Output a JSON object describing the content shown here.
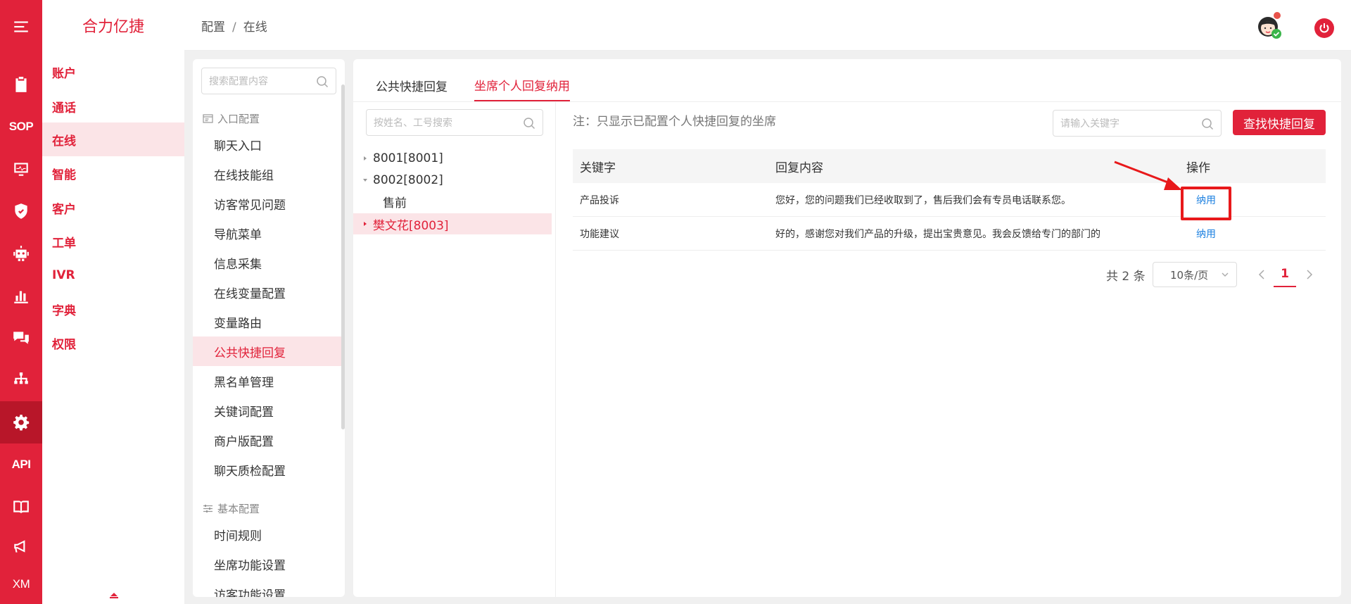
{
  "brand": "合力亿捷",
  "rail": {
    "items": [
      {
        "name": "menu",
        "icon": "hamburger-menu-icon"
      },
      {
        "name": "clipboard",
        "icon": "clipboard-icon"
      },
      {
        "name": "sop",
        "label": "SOP"
      },
      {
        "name": "monitor",
        "icon": "monitor-icon"
      },
      {
        "name": "shield",
        "icon": "shield-icon"
      },
      {
        "name": "robot",
        "icon": "robot-icon"
      },
      {
        "name": "stats",
        "icon": "bar-chart-icon"
      },
      {
        "name": "chat",
        "icon": "chat-bubbles-icon"
      },
      {
        "name": "org",
        "icon": "org-chart-icon"
      },
      {
        "name": "settings",
        "icon": "gear-icon",
        "active": true
      },
      {
        "name": "api",
        "label": "API"
      },
      {
        "name": "book",
        "icon": "book-icon"
      },
      {
        "name": "announce",
        "icon": "megaphone-icon"
      },
      {
        "name": "xm",
        "label": "XM"
      }
    ]
  },
  "modules": [
    "账户",
    "通话",
    "在线",
    "智能",
    "客户",
    "工单",
    "IVR",
    "字典",
    "权限"
  ],
  "active_module": "在线",
  "breadcrumb": {
    "parent": "配置",
    "sep": "/",
    "current": "在线"
  },
  "config_panel": {
    "search_placeholder": "搜索配置内容",
    "group1": "入口配置",
    "group1_items": [
      "聊天入口",
      "在线技能组",
      "访客常见问题",
      "导航菜单",
      "信息采集",
      "在线变量配置",
      "变量路由",
      "公共快捷回复",
      "黑名单管理",
      "关键词配置",
      "商户版配置",
      "聊天质检配置"
    ],
    "active_item": "公共快捷回复",
    "group2": "基本配置",
    "group2_items": [
      "时间规则",
      "坐席功能设置",
      "访客功能设置"
    ]
  },
  "tabs": [
    "公共快捷回复",
    "坐席个人回复纳用"
  ],
  "active_tab": "坐席个人回复纳用",
  "tree": {
    "search_placeholder": "按姓名、工号搜索",
    "nodes": [
      {
        "label": "8001[8001]",
        "expanded": false
      },
      {
        "label": "8002[8002]",
        "expanded": true
      },
      {
        "label": "售前",
        "child": true
      },
      {
        "label": "樊文花[8003]",
        "active": true
      }
    ]
  },
  "note": "注：只显示已配置个人快捷回复的坐席",
  "keyword_search_placeholder": "请输入关键字",
  "find_button": "查找快捷回复",
  "table": {
    "headers": [
      "关键字",
      "回复内容",
      "操作"
    ],
    "rows": [
      {
        "keyword": "产品投诉",
        "content": "您好，您的问题我们已经收取到了，售后我们会有专员电话联系您。",
        "action": "纳用"
      },
      {
        "keyword": "功能建议",
        "content": "好的，感谢您对我们产品的升级，提出宝贵意见。我会反馈给专门的部门的",
        "action": "纳用"
      }
    ]
  },
  "pagination": {
    "total": "共 2 条",
    "page_size": "10条/页",
    "current": "1"
  },
  "colors": {
    "accent": "#e1223a",
    "link": "#1a7fe0",
    "highlight": "#e8191b"
  }
}
